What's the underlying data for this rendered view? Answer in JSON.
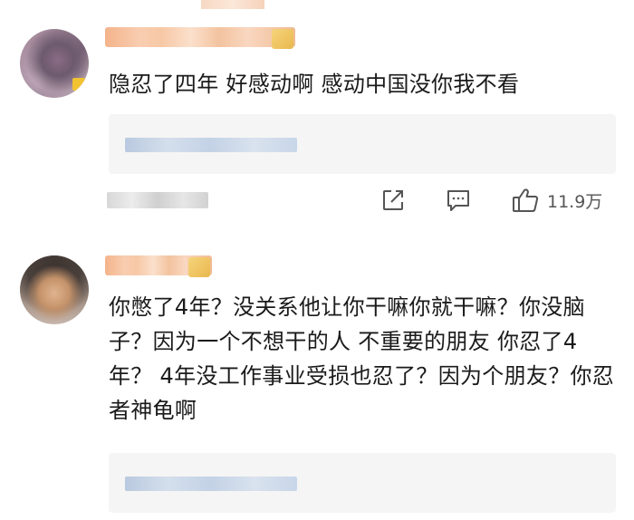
{
  "comments": [
    {
      "text": "隐忍了四年 好感动啊 感动中国没你我不看",
      "likes": "11.9万"
    },
    {
      "text": "你憋了4年？没关系他让你干嘛你就干嘛？你没脑子？因为一个不想干的人 不重要的朋友 你忍了4年？ 4年没工作事业受损也忍了？因为个朋友？你忍者神龟啊"
    }
  ],
  "icons": {
    "share": "share-icon",
    "comment": "comment-icon",
    "like": "thumbs-up-icon"
  },
  "colors": {
    "text": "#1a1a1a",
    "icon": "#555555",
    "reply_bg": "#f5f5f5"
  }
}
